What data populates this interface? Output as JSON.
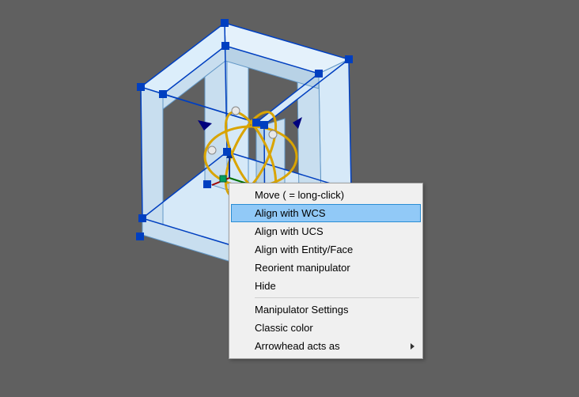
{
  "menu": {
    "items": [
      {
        "label": "Move ( = long-click)"
      },
      {
        "label": "Align with WCS",
        "highlighted": true
      },
      {
        "label": "Align with UCS"
      },
      {
        "label": "Align with Entity/Face"
      },
      {
        "label": "Reorient manipulator"
      },
      {
        "label": "Hide"
      }
    ],
    "items2": [
      {
        "label": "Manipulator Settings"
      },
      {
        "label": "Classic color"
      },
      {
        "label": "Arrowhead acts as",
        "submenu": true
      }
    ]
  },
  "model": {
    "fill": "#d6e9f8",
    "edge": "#6398c7",
    "selected_edge": "#003fc0",
    "grip": "#003fc0",
    "manipulator_ring": "#d9a400",
    "manipulator_ball": "#d0d0d0",
    "axis_z": "#003090",
    "axis_x": "#007000",
    "axis_y": "#a00000"
  }
}
